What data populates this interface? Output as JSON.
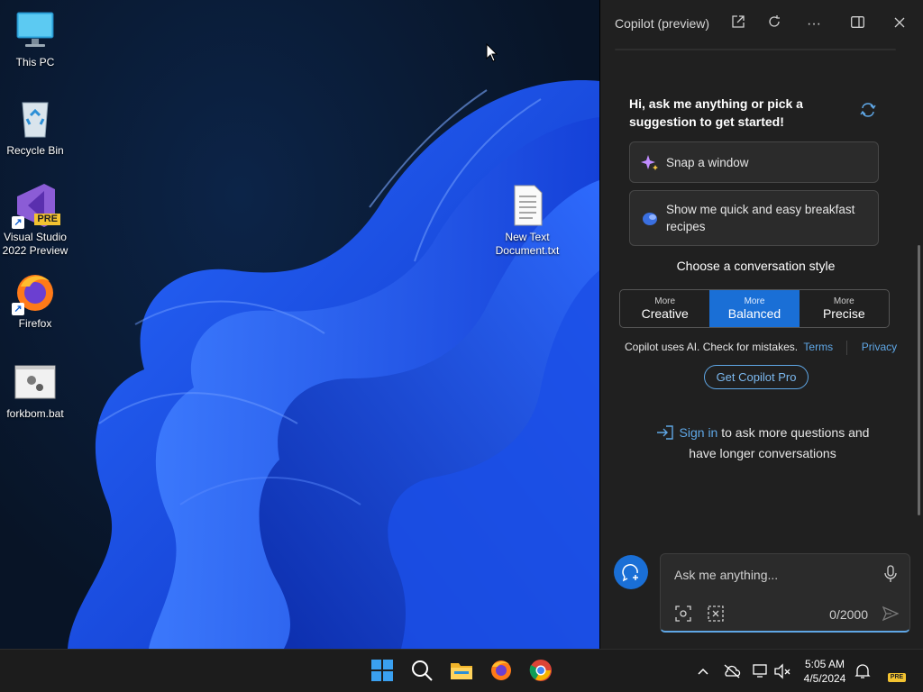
{
  "desktop": {
    "icons": [
      {
        "label": "This PC"
      },
      {
        "label": "Recycle Bin"
      },
      {
        "label": "Visual Studio 2022 Preview"
      },
      {
        "label": "Firefox"
      },
      {
        "label": "forkbom.bat"
      },
      {
        "label": "New Text Document.txt"
      }
    ],
    "vs_badge": "PRE"
  },
  "copilot": {
    "title": "Copilot (preview)",
    "greeting": "Hi, ask me anything or pick a suggestion to get started!",
    "suggestions": [
      {
        "label": "Snap a window",
        "icon": "sparkle-icon"
      },
      {
        "label": "Show me quick and easy breakfast recipes",
        "icon": "chat-bubble-icon"
      }
    ],
    "style_label": "Choose a conversation style",
    "styles": [
      {
        "small": "More",
        "big": "Creative",
        "active": false
      },
      {
        "small": "More",
        "big": "Balanced",
        "active": true
      },
      {
        "small": "More",
        "big": "Precise",
        "active": false
      }
    ],
    "disclaimer": "Copilot uses AI. Check for mistakes.",
    "terms": "Terms",
    "privacy": "Privacy",
    "pro_button": "Get Copilot Pro",
    "signin_link": "Sign in",
    "signin_text": " to ask more questions and have longer conversations",
    "input_placeholder": "Ask me anything...",
    "char_count": "0/2000"
  },
  "taskbar": {
    "time": "5:05 AM",
    "date": "4/5/2024",
    "badge": "PRE"
  },
  "colors": {
    "accent": "#1a6fd6",
    "link": "#5fa7e6",
    "panel_bg": "#202020"
  }
}
